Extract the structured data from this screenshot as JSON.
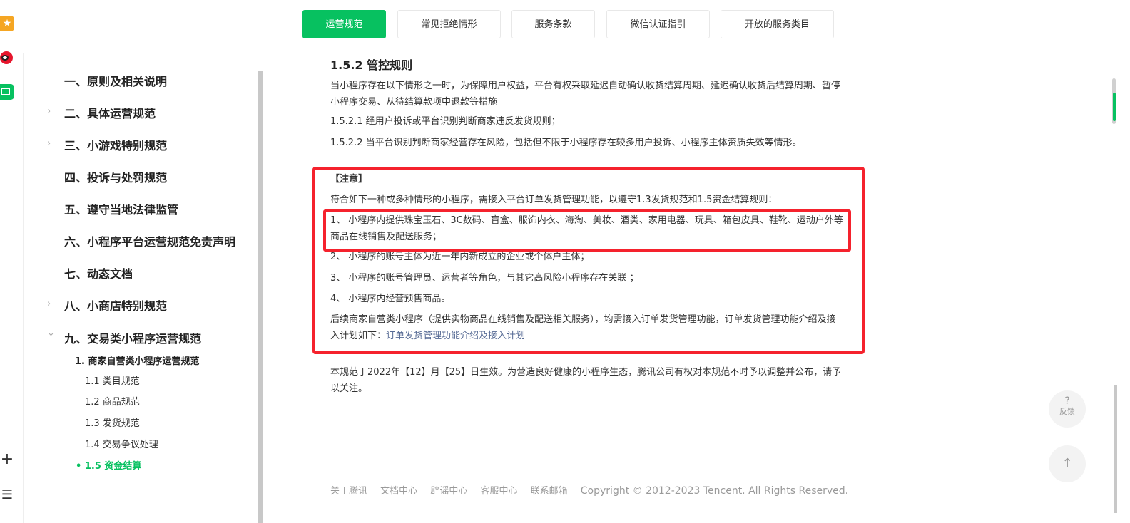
{
  "tabs": [
    {
      "label": "运营规范",
      "active": true
    },
    {
      "label": "常见拒绝情形",
      "active": false
    },
    {
      "label": "服务条款",
      "active": false
    },
    {
      "label": "微信认证指引",
      "active": false
    },
    {
      "label": "开放的服务类目",
      "active": false
    }
  ],
  "sidebar": {
    "items": [
      {
        "label": "一、原则及相关说明",
        "arrow": ""
      },
      {
        "label": "二、具体运营规范",
        "arrow": "›"
      },
      {
        "label": "三、小游戏特别规范",
        "arrow": "›"
      },
      {
        "label": "四、投诉与处罚规范",
        "arrow": ""
      },
      {
        "label": "五、遵守当地法律监管",
        "arrow": ""
      },
      {
        "label": "六、小程序平台运营规范免责声明",
        "arrow": ""
      },
      {
        "label": "七、动态文档",
        "arrow": ""
      },
      {
        "label": "八、小商店特别规范",
        "arrow": "›"
      },
      {
        "label": "九、交易类小程序运营规范",
        "arrow": "⌄"
      }
    ],
    "sub_title": "1. 商家自营类小程序运营规范",
    "sub_items": [
      "1.1 类目规范",
      "1.2 商品规范",
      "1.3 发货规范",
      "1.4 交易争议处理"
    ],
    "active_item": "• 1.5 资金结算"
  },
  "content": {
    "heading": "1.5.2 管控规则",
    "intro": "当小程序存在以下情形之一时，为保障用户权益，平台有权采取延迟自动确认收货结算周期、延迟确认收货后结算周期、暂停小程序交易、从待结算款项中退款等措施",
    "rule1": "1.5.2.1 经用户投诉或平台识别判断商家违反发货规则；",
    "rule2": "1.5.2.2 当平台识别判断商家经营存在风险，包括但不限于小程序存在较多用户投诉、小程序主体资质失效等情形。",
    "notice_title": "【注意】",
    "notice_intro": "符合如下一种或多种情形的小程序，需接入平台订单发货管理功能，以遵守1.3发货规范和1.5资金结算规则：",
    "n1": "1、 小程序内提供珠宝玉石、3C数码、盲盒、服饰内衣、海淘、美妆、酒类、家用电器、玩具、箱包皮具、鞋靴、运动户外等商品在线销售及配送服务；",
    "n2": "2、 小程序的账号主体为近一年内新成立的企业或个体户主体；",
    "n3": "3、 小程序的账号管理员、运营者等角色，与其它高风险小程序存在关联 ；",
    "n4": "4、 小程序内经营预售商品。",
    "follow": "后续商家自营类小程序（提供实物商品在线销售及配送相关服务），均需接入订单发货管理功能，订单发货管理功能介绍及接入计划如下：",
    "follow_link": "订单发货管理功能介绍及接入计划",
    "effective": "本规范于2022年【12】月【25】日生效。为营造良好健康的小程序生态，腾讯公司有权对本规范不时予以调整并公布，请予以关注。"
  },
  "footer": {
    "links": [
      "关于腾讯",
      "文档中心",
      "辟谣中心",
      "客服中心",
      "联系邮箱"
    ],
    "copyright": "Copyright © 2012-2023 Tencent. All Rights Reserved."
  },
  "float": {
    "feedback_icon": "?",
    "feedback_label": "反馈",
    "top_icon": "↑"
  }
}
